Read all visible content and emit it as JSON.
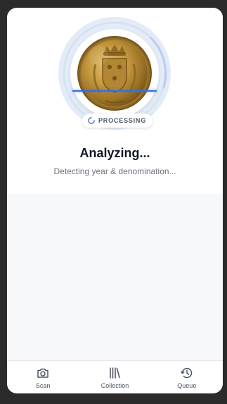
{
  "scanner": {
    "status_label": "PROCESSING",
    "progress_ring_color": "#c9d8f2",
    "scan_line_color": "#3b6fd4"
  },
  "main": {
    "title": "Analyzing...",
    "subtitle": "Detecting year & denomination..."
  },
  "tabs": [
    {
      "label": "Scan",
      "icon": "camera-icon"
    },
    {
      "label": "Collection",
      "icon": "library-icon"
    },
    {
      "label": "Queue",
      "icon": "history-icon"
    }
  ]
}
